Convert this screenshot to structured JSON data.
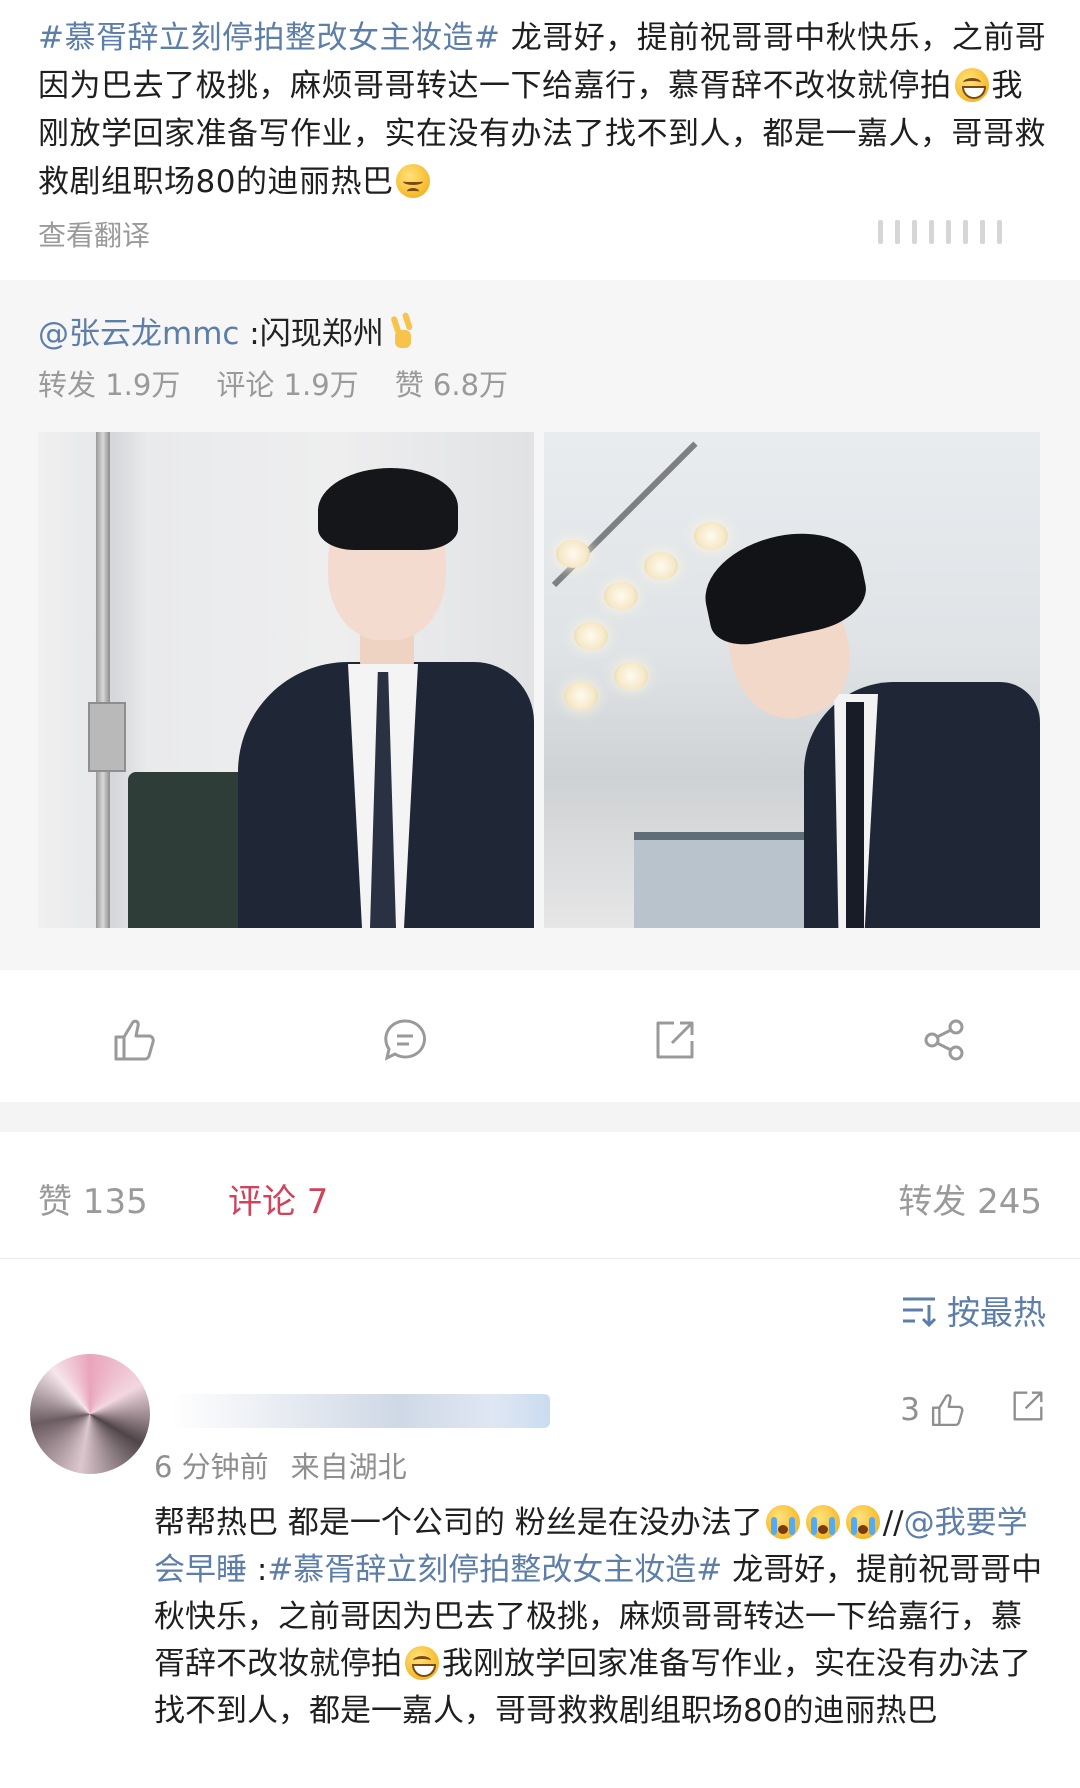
{
  "post": {
    "hashtag": "#慕胥辞立刻停拍整改女主妆造#",
    "text_part1": " 龙哥好，提前祝哥哥中秋快乐，之前哥因为巴去了极挑，麻烦哥哥转达一下给嘉行，慕胥辞不改妆就停拍",
    "text_part2": "我刚放学回家准备写作业，实在没有办法了找不到人，都是一嘉人，哥哥救救剧组职场80的迪丽热巴",
    "translate_label": "查看翻译",
    "emojis": [
      "grinning-face",
      "pensive-face"
    ]
  },
  "repost": {
    "author_mention": "@张云龙mmc",
    "author_text": " :闪现郑州",
    "stats": {
      "repost": "转发 1.9万",
      "comment": "评论 1.9万",
      "like": "赞 6.8万"
    },
    "photos": [
      {
        "icon": "photo-man-in-suit-leaning"
      },
      {
        "icon": "photo-man-in-suit-looking-down"
      }
    ]
  },
  "actions": {
    "like_icon": "thumbs-up-icon",
    "comment_icon": "comment-icon",
    "repost_icon": "repost-icon",
    "share_icon": "share-icon"
  },
  "tabs": {
    "like": "赞 135",
    "comment": "评论 7",
    "repost": "转发 245",
    "active_color": "#d0435b"
  },
  "sort": {
    "label": "按最热"
  },
  "comment": {
    "time": "6 分钟前",
    "location": "来自湖北",
    "like_count": "3",
    "text_start": "帮帮热巴 都是一个公司的 粉丝是在没办法了",
    "repost_prefix": "//",
    "mention": "@我要学会早睡",
    "colon": " :",
    "hashtag": "#慕胥辞立刻停拍整改女主妆造#",
    "text_mid": " 龙哥好，提前祝哥哥中秋快乐，之前哥因为巴去了极挑，麻烦哥哥转达一下给嘉行，慕胥辞不改妆就停拍",
    "text_end": "我刚放学回家准备写作业，实在没有办法了找不到人，都是一嘉人，哥哥救救剧组职场80的迪丽热巴"
  },
  "colors": {
    "link": "#5d7ea9",
    "muted": "#9a9a9a",
    "accent": "#d0435b"
  }
}
